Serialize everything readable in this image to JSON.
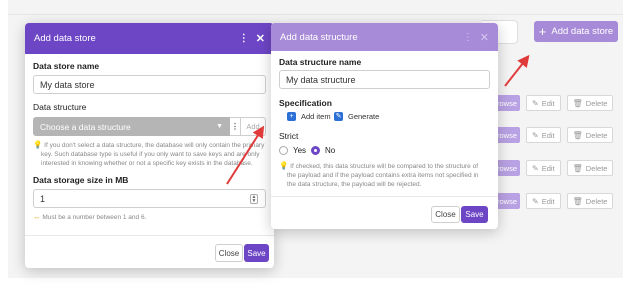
{
  "background": {
    "add_store_button": "Add data store",
    "rows": [
      {
        "browse": "rowse",
        "edit": "Edit",
        "delete": "Delete"
      },
      {
        "browse": "rowse",
        "edit": "Edit",
        "delete": "Delete"
      },
      {
        "browse": "rowse",
        "edit": "Edit",
        "delete": "Delete"
      },
      {
        "browse": "rowse",
        "edit": "Edit",
        "delete": "Delete"
      }
    ]
  },
  "add_store_dialog": {
    "title": "Add data store",
    "store_name_label": "Data store name",
    "store_name_value": "My data store",
    "structure_label": "Data structure",
    "structure_placeholder": "Choose a data structure",
    "structure_add": "Add",
    "structure_hint_1": "If you don't select a data structure, the database will only contain the primary",
    "structure_hint_2": "key. Such database type is useful if you only want to save keys and are only",
    "structure_hint_3": "interested in knowing whether or not a specific key exists in the database.",
    "size_label": "Data storage size in MB",
    "size_value": "1",
    "size_hint": "Must be a number between 1 and 6.",
    "close_label": "Close",
    "save_label": "Save"
  },
  "add_structure_dialog": {
    "title": "Add data structure",
    "name_label": "Data structure name",
    "name_value": "My data structure",
    "spec_label": "Specification",
    "add_item_label": "Add item",
    "generate_label": "Generate",
    "strict_label": "Strict",
    "yes_label": "Yes",
    "no_label": "No",
    "strict_selected": "No",
    "hint_1": "If checked, this data structure will be compared to the structure of",
    "hint_2": "the payload and if the payload contains extra items not specified in",
    "hint_3": "the data structure, the payload will be rejected.",
    "close_label": "Close",
    "save_label": "Save"
  },
  "colors": {
    "primary": "#6d46c6",
    "primary_light": "#a88bd8",
    "annotation_arrow": "#e03a3a"
  }
}
